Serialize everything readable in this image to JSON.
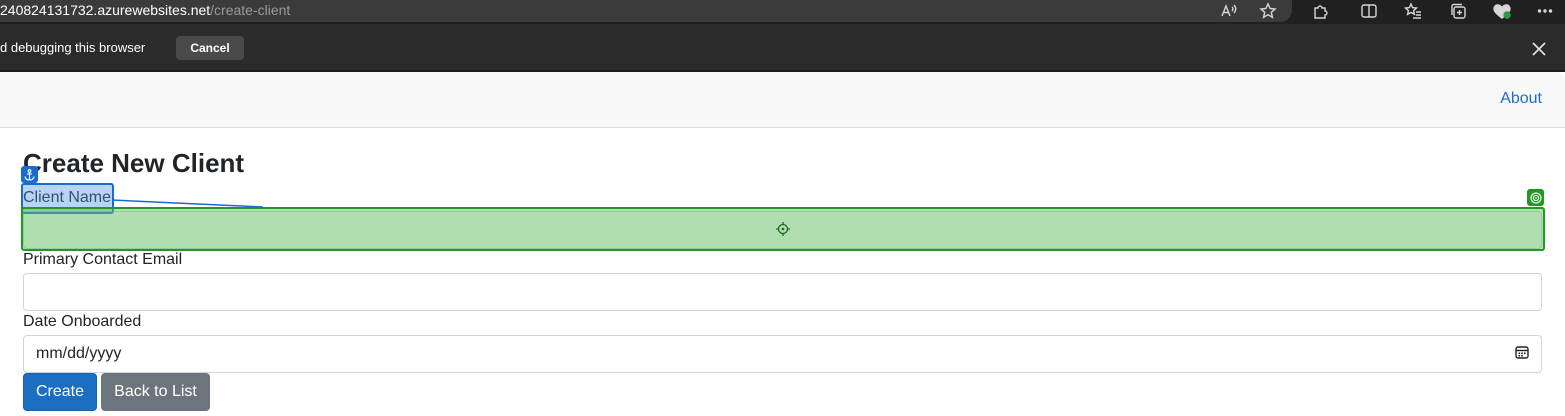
{
  "browser": {
    "url_host": "240824131732.azurewebsites.net",
    "url_path": "/create-client",
    "debug_message": "d debugging this browser",
    "cancel_label": "Cancel"
  },
  "navbar": {
    "about_label": "About"
  },
  "page": {
    "title": "Create New Client"
  },
  "form": {
    "client_name_label": "Client Name",
    "client_name_value": "",
    "email_label": "Primary Contact Email",
    "email_value": "",
    "date_label": "Date Onboarded",
    "date_placeholder": "mm/dd/yyyy"
  },
  "actions": {
    "create_label": "Create",
    "back_label": "Back to List"
  },
  "icons": [
    "read-aloud-icon",
    "favorite-star-icon",
    "extensions-icon",
    "split-screen-icon",
    "favorites-icon",
    "collections-icon",
    "browser-essentials-icon",
    "more-icon",
    "close-icon",
    "calendar-icon",
    "anchor-icon",
    "target-icon",
    "crosshair-icon"
  ],
  "colors": {
    "link": "#1b6ec2",
    "primary_button": "#1b6ec2",
    "secondary_button": "#6c757d",
    "annotation_blue": "#1a6ad4",
    "annotation_green": "#1f9a1f"
  }
}
